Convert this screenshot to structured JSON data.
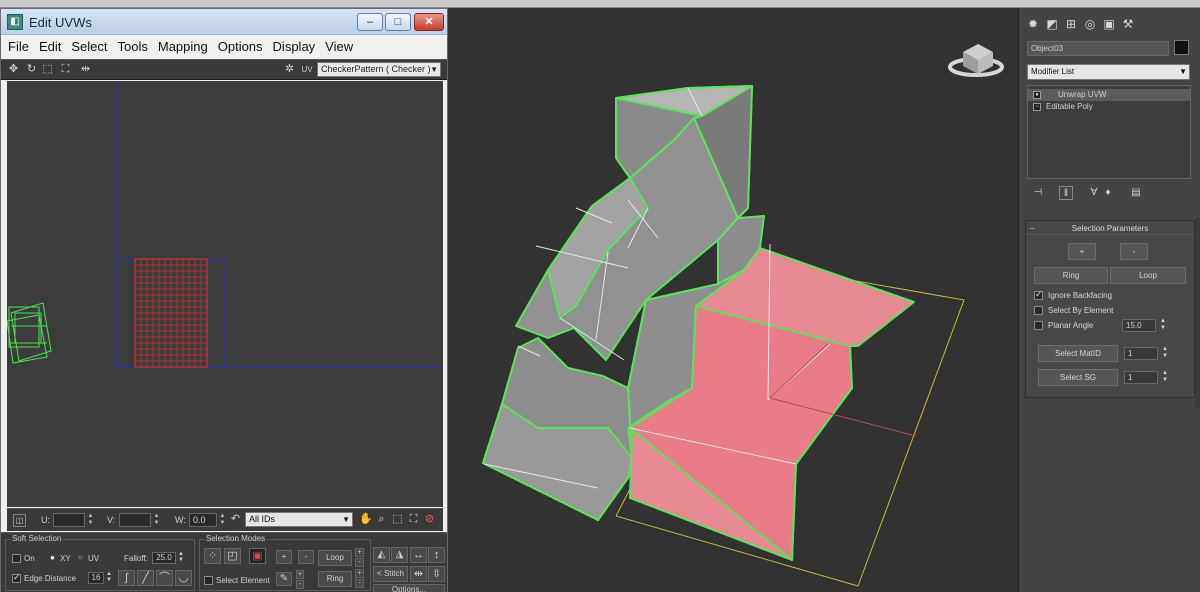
{
  "uvw_window": {
    "title": "Edit UVWs",
    "window_buttons": {
      "minimize": "–",
      "maximize": "□",
      "close": "✕"
    },
    "menu": [
      "File",
      "Edit",
      "Select",
      "Tools",
      "Mapping",
      "Options",
      "Display",
      "View"
    ],
    "toolbar": {
      "icons": [
        "move-icon",
        "rotate-icon",
        "scale-icon",
        "freeform-icon",
        "mirror-icon"
      ],
      "uv_label": "UV",
      "texture_dropdown": "CheckerPattern  ( Checker )"
    },
    "bottom_bar": {
      "u_label": "U:",
      "u_value": "",
      "v_label": "V:",
      "v_value": "",
      "w_label": "W:",
      "w_value": "0.0",
      "ids_dropdown": "All IDs"
    },
    "soft_selection": {
      "title": "Soft Selection",
      "on_label": "On",
      "xy_label": "XY",
      "uv_label": "UV",
      "falloff_label": "Falloff:",
      "falloff_value": "25.0",
      "edge_distance_label": "Edge Distance",
      "edge_distance_value": "16",
      "edge_distance_checked": true
    },
    "selection_modes": {
      "title": "Selection Modes",
      "select_element_label": "Select Element",
      "plus_label": "+",
      "minus_label": "-",
      "loop_label": "Loop",
      "ring_label": "Ring",
      "stitch_label": "< Stitch >",
      "options_label": "Options..."
    }
  },
  "command_panel": {
    "object_name": "Object03",
    "object_color": "#111111",
    "modifier_list_label": "Modifier List",
    "stack": [
      {
        "label": "Unwrap UVW",
        "selected": true
      },
      {
        "label": "Editable Poly",
        "selected": false
      }
    ],
    "selection_parameters": {
      "title": "Selection Parameters",
      "grow_label": "+",
      "shrink_label": "-",
      "ring_label": "Ring",
      "loop_label": "Loop",
      "ignore_backfacing_label": "Ignore Backfacing",
      "ignore_backfacing_checked": true,
      "select_by_element_label": "Select By Element",
      "planar_angle_label": "Planar Angle",
      "planar_angle_value": "15.0",
      "select_matid_label": "Select MatID",
      "matid_value": "1",
      "select_sg_label": "Select SG",
      "sg_value": "1"
    }
  },
  "colors": {
    "model_fill": "#8f8f8f",
    "selected_faces": "#e88a93",
    "edge_highlight": "#5fe05f",
    "uv_grid": "#d2303a",
    "bbox": "#c9b84a"
  }
}
